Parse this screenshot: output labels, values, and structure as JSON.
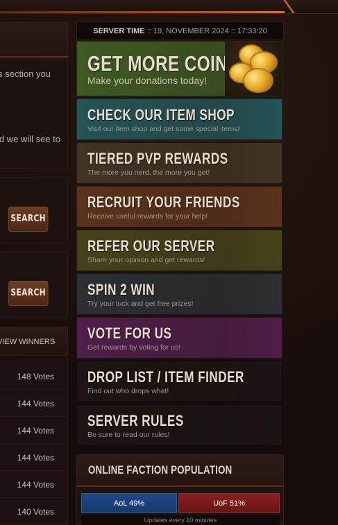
{
  "left": {
    "info_text_1": "s section you",
    "info_text_2": "d we will see to",
    "search_label_1": "SEARCH",
    "search_label_2": "SEARCH",
    "view_winners": "VIEW WINNERS",
    "votes": [
      "148 Votes",
      "144 Votes",
      "144 Votes",
      "144 Votes",
      "144 Votes",
      "140 Votes"
    ]
  },
  "server_time": {
    "label": "SERVER TIME",
    "value": ":: 19, NOVEMBER 2024 :: 17:33:20"
  },
  "banners": [
    {
      "title": "GET MORE COINS",
      "subtitle": "Make your donations today!",
      "color": "#3e5a22"
    },
    {
      "title": "CHECK OUR ITEM SHOP",
      "subtitle": "Visit our item shop and get some special items!",
      "color": "#245457"
    },
    {
      "title": "TIERED PVP REWARDS",
      "subtitle": "The more you nerd, the more you get!",
      "color": "#3f3425"
    },
    {
      "title": "RECRUIT YOUR FRIENDS",
      "subtitle": "Receive useful rewards for your help!",
      "color": "#5a331c"
    },
    {
      "title": "REFER OUR SERVER",
      "subtitle": "Share your opinion and get rewards!",
      "color": "#45431b"
    },
    {
      "title": "SPIN 2 WIN",
      "subtitle": "Try your luck and get free prizes!",
      "color": "#2c2f33"
    },
    {
      "title": "VOTE FOR US",
      "subtitle": "Get rewards by voting for us!",
      "color": "#4f1f4a"
    },
    {
      "title": "DROP LIST / ITEM FINDER",
      "subtitle": "Find out who drops what!",
      "color": "#1c1514"
    },
    {
      "title": "SERVER RULES",
      "subtitle": "Be sure to read our rules!",
      "color": "#1c1514"
    }
  ],
  "faction": {
    "title": "ONLINE FACTION POPULATION",
    "aol_label": "AoL 49%",
    "aol_share": 49,
    "uof_label": "UoF 51%",
    "uof_share": 51,
    "aol_color": "#1e4a8a",
    "uof_color": "#8a1e1e",
    "updates": "Updates every 10 minutes"
  }
}
